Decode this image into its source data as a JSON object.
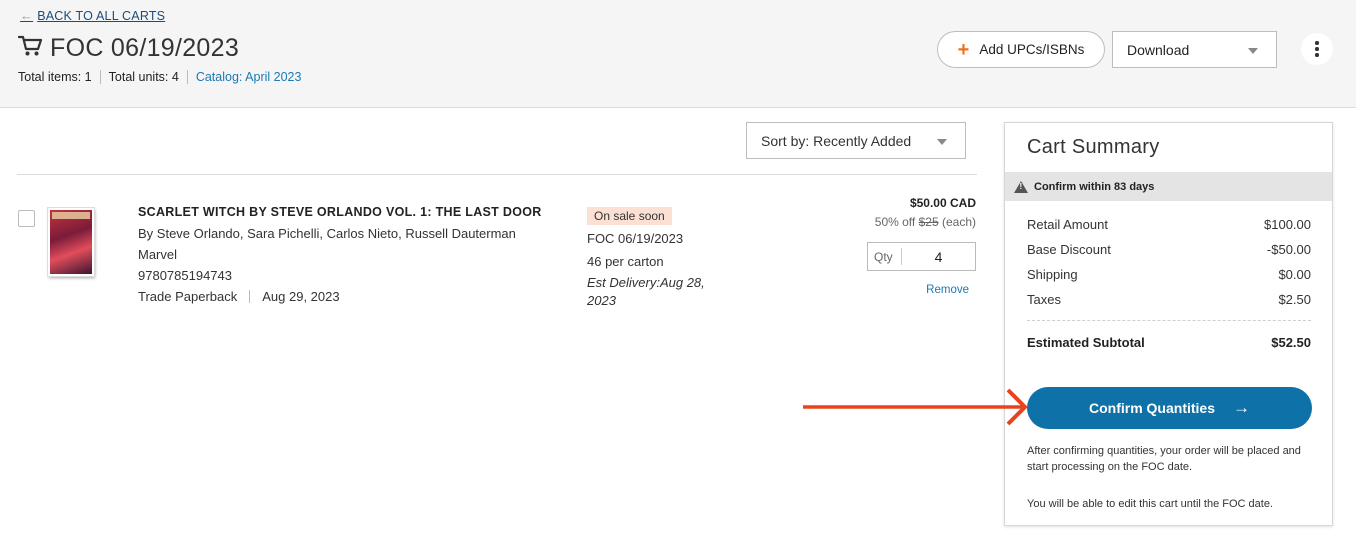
{
  "header": {
    "back_label": "BACK TO ALL CARTS",
    "cart_title": "FOC 06/19/2023",
    "total_items": "Total items: 1",
    "total_units": "Total units: 4",
    "catalog": "Catalog: April 2023",
    "add_label": "Add UPCs/ISBNs",
    "download_label": "Download"
  },
  "sort": {
    "label": "Sort by: Recently Added"
  },
  "item": {
    "title": "SCARLET WITCH BY STEVE ORLANDO VOL. 1: THE LAST DOOR",
    "authors": "By Steve Orlando, Sara Pichelli, Carlos Nieto, Russell Dauterman",
    "publisher": "Marvel",
    "isbn": "9780785194743",
    "format": "Trade Paperback",
    "date": "Aug 29, 2023",
    "badge": "On sale soon",
    "foc": "FOC 06/19/2023",
    "carton": "46 per carton",
    "est_delivery": "Est Delivery:Aug 28, 2023",
    "price": "$50.00 CAD",
    "discount_prefix": "50% off",
    "original_price": "$25",
    "discount_suffix": "(each)",
    "qty_label": "Qty",
    "qty_value": "4",
    "remove_label": "Remove"
  },
  "summary": {
    "title": "Cart Summary",
    "confirm_within": "Confirm within 83 days",
    "rows": [
      {
        "label": "Retail Amount",
        "value": "$100.00"
      },
      {
        "label": "Base Discount",
        "value": "-$50.00"
      },
      {
        "label": "Shipping",
        "value": "$0.00"
      },
      {
        "label": "Taxes",
        "value": "$2.50"
      }
    ],
    "subtotal_label": "Estimated Subtotal",
    "subtotal_value": "$52.50",
    "confirm_button": "Confirm Quantities",
    "note1": "After confirming quantities, your order will be placed and start processing on the FOC date.",
    "note2": "You will be able to edit this cart until the FOC date."
  },
  "colors": {
    "accent": "#0e72a8",
    "link": "#1a7ab5",
    "plus": "#e8731e",
    "annotation_arrow": "#e8431e",
    "badge_bg": "#fbe0d3"
  },
  "icons": [
    "arrow-left-icon",
    "cart-icon",
    "plus-icon",
    "caret-down-icon",
    "kebab-icon",
    "warning-icon",
    "arrow-right-icon"
  ]
}
